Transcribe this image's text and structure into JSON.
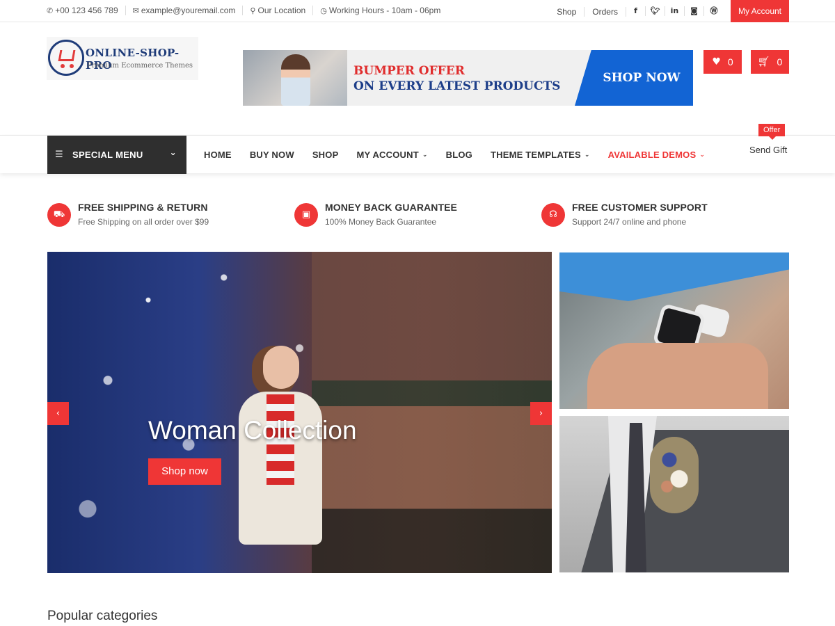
{
  "topbar": {
    "phone": "+00 123 456 789",
    "email": "example@youremail.com",
    "location": "Our Location",
    "hours": "Working Hours - 10am - 06pm",
    "links": [
      "Shop",
      "Orders"
    ],
    "social_icons": [
      "facebook-icon",
      "twitter-icon",
      "linkedin-icon",
      "instagram-icon",
      "wordpress-icon"
    ],
    "account_label": "My Account"
  },
  "logo": {
    "name": "ONLINE-SHOP-PRO",
    "tagline": "Premium Ecommerce Themes"
  },
  "banner": {
    "line1": "BUMPER OFFER",
    "line2": "ON EVERY LATEST PRODUCTS",
    "cta": "SHOP NOW"
  },
  "header": {
    "wishlist_count": "0",
    "cart_count": "0"
  },
  "nav": {
    "special_menu": "SPECIAL MENU",
    "items": [
      {
        "label": "HOME"
      },
      {
        "label": "BUY NOW"
      },
      {
        "label": "SHOP"
      },
      {
        "label": "MY ACCOUNT",
        "dropdown": true
      },
      {
        "label": "BLOG"
      },
      {
        "label": "THEME TEMPLATES",
        "dropdown": true
      },
      {
        "label": "AVAILABLE DEMOS",
        "dropdown": true,
        "color": "#ef3636"
      }
    ],
    "gift_label": "Send Gift",
    "gift_badge": "Offer"
  },
  "features": [
    {
      "title": "FREE SHIPPING & RETURN",
      "subtitle": "Free Shipping on all order over $99",
      "icon": "truck-icon"
    },
    {
      "title": "MONEY BACK GUARANTEE",
      "subtitle": "100% Money Back Guarantee",
      "icon": "money-icon"
    },
    {
      "title": "FREE CUSTOMER SUPPORT",
      "subtitle": "Support 24/7 online and phone",
      "icon": "headset-icon"
    }
  ],
  "slider": {
    "caption": "Woman Collection",
    "button": "Shop now"
  },
  "section": {
    "popular_title": "Popular categories"
  },
  "colors": {
    "accent": "#ef3636",
    "dark": "#2f2f2f",
    "banner_blue": "#1264d4"
  }
}
